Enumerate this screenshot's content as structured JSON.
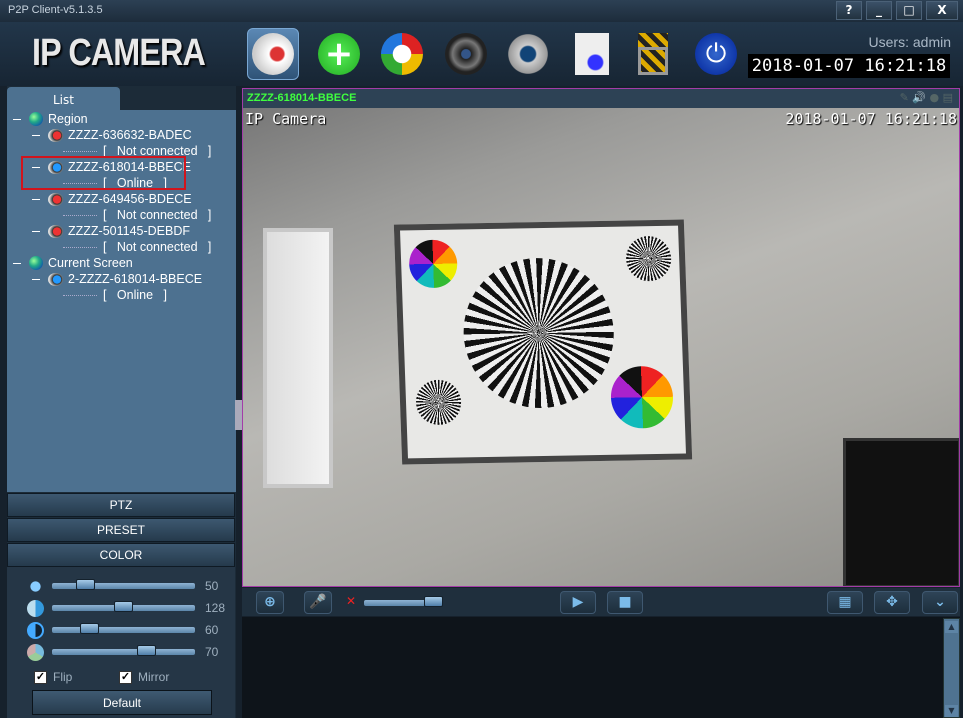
{
  "window": {
    "title": "P2P Client-v5.1.3.5",
    "help": "?",
    "minimize": "_",
    "maximize": "□",
    "close": "X"
  },
  "header": {
    "logo": "IP CAMERA",
    "users": "Users: admin",
    "datetime": "2018-01-07  16:21:18",
    "toolbar": [
      "monitor-camera-icon",
      "add-device-icon",
      "playback-icon",
      "film-reel-icon",
      "settings-gear-icon",
      "log-document-icon",
      "lock-icon",
      "power-icon"
    ]
  },
  "sidebar": {
    "tab": "List",
    "tree": [
      {
        "label": "Region",
        "type": "group"
      },
      {
        "label": "ZZZZ-636632-BADEC",
        "status": "Not connected",
        "online": false
      },
      {
        "label": "ZZZZ-618014-BBECE",
        "status": "Online",
        "online": true,
        "highlighted": true
      },
      {
        "label": "ZZZZ-649456-BDECE",
        "status": "Not connected",
        "online": false
      },
      {
        "label": "ZZZZ-501145-DEBDF",
        "status": "Not connected",
        "online": false
      },
      {
        "label": "Current Screen",
        "type": "group"
      },
      {
        "label": "2-ZZZZ-618014-BBECE",
        "status": "Online",
        "online": true
      }
    ],
    "sections": {
      "ptz": "PTZ",
      "preset": "PRESET",
      "color": "COLOR"
    },
    "color": {
      "brightness": "50",
      "hue": "128",
      "contrast": "60",
      "saturation": "70",
      "flip_label": "Flip",
      "flip": true,
      "mirror_label": "Mirror",
      "mirror": true,
      "default_label": "Default"
    }
  },
  "video": {
    "channel": "ZZZZ-618014-BBECE",
    "osd_name": "IP Camera",
    "osd_time": "2018-01-07 16:21:18",
    "volume_muted": true
  },
  "colors": {
    "channel_text": "#3fff3f",
    "selection_border": "#d2141c",
    "video_border": "#a33ca8"
  }
}
